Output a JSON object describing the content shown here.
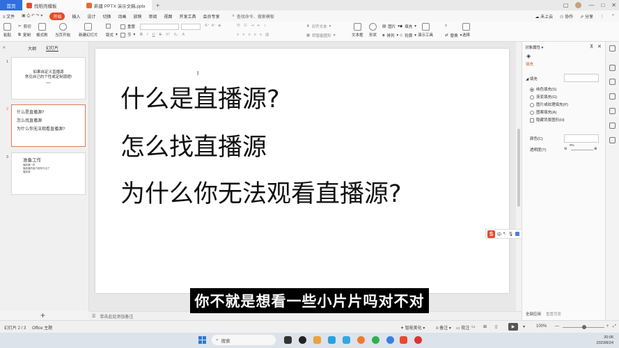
{
  "titlebar": {
    "home": "首页",
    "tab1": "找稻壳模板",
    "tab2": "新建 PPTX 演示文稿.pptx",
    "plus": "+"
  },
  "menubar": {
    "file": "≡ 文件",
    "items": [
      "开始",
      "插入",
      "设计",
      "切换",
      "动画",
      "放映",
      "审阅",
      "视图",
      "开发工具",
      "会员专享"
    ],
    "search": "查找命令、搜索模板",
    "unsaved": "未上云",
    "collab": "协作",
    "share": "分享"
  },
  "ribbon": {
    "paste": "粘贴",
    "cut": "剪切",
    "copy": "复制",
    "format_painter": "格式刷",
    "from_start": "当页开始",
    "new_slide": "新建幻灯片",
    "layout": "版式",
    "section": "节",
    "reset": "重置",
    "text_box": "文本框",
    "shape": "形状",
    "arrange": "排列",
    "picture": "图片",
    "fill": "填充",
    "outline": "轮廓",
    "present_tools": "演示工具",
    "replace": "替换",
    "select": "选择",
    "align_text": "对齐文本",
    "smart_graphic": "转智能图形"
  },
  "leftpanel": {
    "tab_outline": "大纲",
    "tab_slides": "幻灯片",
    "slides": [
      {
        "num": "1",
        "title": "如果自定义直播源",
        "sub": "常见自己的个性或定制源题!",
        "small": "xxxx"
      },
      {
        "num": "2",
        "lines": [
          "什么是直播源?",
          "怎么找直播源",
          "为什么你无法观看直播源?"
        ]
      },
      {
        "num": "3",
        "title": "准备工作",
        "bullets": [
          "播放器一机",
          "播放器的客户都有外出了",
          "播放源"
        ]
      }
    ]
  },
  "slide": {
    "line1": "什么是直播源?",
    "line2": "怎么找直播源",
    "line3": "为什么你无法观看直播源?"
  },
  "notes": "单击此处添加备注",
  "subtitle": "你不就是想看一些小片片吗对不对",
  "rightpane": {
    "title": "对象属性 ▾",
    "tab_fill": "填充",
    "fill_header": "◢ 填充",
    "opt1": "纯色填充(S)",
    "opt2": "渐变填充(G)",
    "opt3": "图片或纹理填充(P)",
    "opt4": "图案填充(A)",
    "opt5": "隐藏背景图形(H)",
    "color": "颜色(C)",
    "transparency": "透明度(T)",
    "trans_value": "0%",
    "apply_all": "全部应用",
    "reset_bg": "重置背景"
  },
  "ime": {
    "s": "S",
    "lang": "中"
  },
  "statusbar": {
    "slide_count": "幻灯片 2 / 3",
    "theme": "Office 主题",
    "smart_beauty": "智能美化",
    "notes_btn": "备注",
    "comments": "批注",
    "zoom": "100%"
  },
  "taskbar": {
    "search": "搜索",
    "time": "20:06",
    "date": "2023/8/24"
  },
  "colors": {
    "accent_red": "#e8492f",
    "home_blue": "#2f6fe0"
  }
}
